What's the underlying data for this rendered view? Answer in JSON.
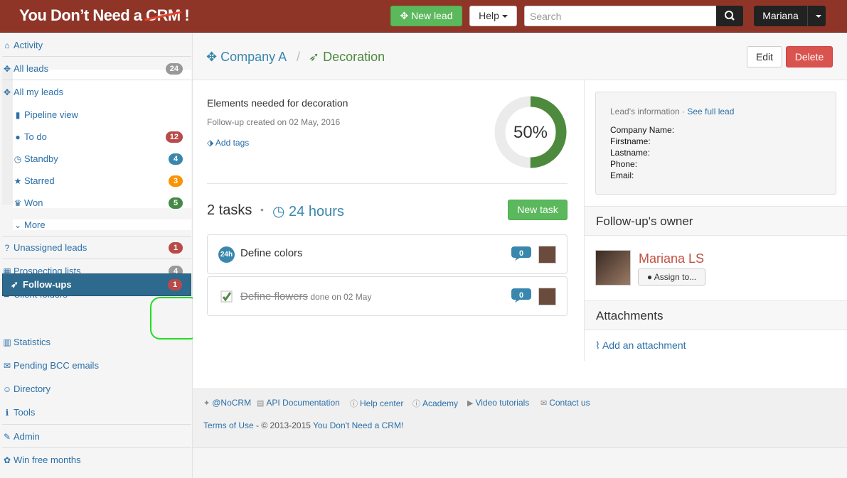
{
  "brand": {
    "logo_prefix": "You Don’t Need a ",
    "logo_strike": "CRM",
    "logo_suffix": " !"
  },
  "topbar": {
    "new_lead": "New lead",
    "help": "Help",
    "search_placeholder": "Search",
    "user": "Mariana"
  },
  "sidebar": {
    "activity": "Activity",
    "all_leads": {
      "label": "All leads",
      "count": "24"
    },
    "all_my_leads": "All my leads",
    "pipeline_view": "Pipeline view",
    "to_do": {
      "label": "To do",
      "count": "12"
    },
    "standby": {
      "label": "Standby",
      "count": "4"
    },
    "starred": {
      "label": "Starred",
      "count": "3"
    },
    "won": {
      "label": "Won",
      "count": "5"
    },
    "more": "More",
    "unassigned": {
      "label": "Unassigned leads",
      "count": "1"
    },
    "prospecting": {
      "label": "Prospecting lists",
      "count": "4"
    },
    "client_folders": "Client folders",
    "follow_ups": {
      "label": "Follow-ups",
      "count": "1"
    },
    "statistics": "Statistics",
    "pending_bcc": "Pending BCC emails",
    "directory": "Directory",
    "tools": "Tools",
    "admin": "Admin",
    "win_free": "Win free months"
  },
  "header": {
    "company": "Company A",
    "separator": "/",
    "followup": "Decoration",
    "edit": "Edit",
    "delete": "Delete"
  },
  "followup": {
    "title": "Elements needed for decoration",
    "created": "Follow-up created on 02 May, 2016",
    "add_tags": "Add tags",
    "progress_label": "50%",
    "progress": 0.5
  },
  "tasks": {
    "count_label": "2 tasks",
    "dot": "•",
    "hours": "24 hours",
    "new_task": "New task",
    "items": [
      {
        "badge": "24h",
        "name": "Define colors",
        "comments": "0",
        "done": false
      },
      {
        "name": "Define flowers",
        "meta": " done on 02 May",
        "comments": "0",
        "done": true
      }
    ]
  },
  "lead_info": {
    "heading": "Lead's information · ",
    "see_full": "See full lead",
    "fields": [
      "Company Name:",
      "Firstname:",
      "Lastname:",
      "Phone:",
      "Email:"
    ]
  },
  "owner": {
    "title": "Follow-up's owner",
    "name": "Mariana LS",
    "assign": "Assign to..."
  },
  "attachments": {
    "title": "Attachments",
    "add": "Add an attachment"
  },
  "footer": {
    "links": [
      "@NoCRM",
      "API Documentation",
      "Help center",
      "Academy",
      "Video tutorials",
      "Contact us"
    ],
    "terms": "Terms of Use",
    "copyright": " - © 2013-2015 ",
    "company": "You Don't Need a CRM!"
  },
  "colors": {
    "brand": "#8f3528",
    "active_nav": "#2e6a8e",
    "link": "#2a6fa8",
    "progress": "#4e8a3e",
    "accent_green": "#5cb85c"
  }
}
